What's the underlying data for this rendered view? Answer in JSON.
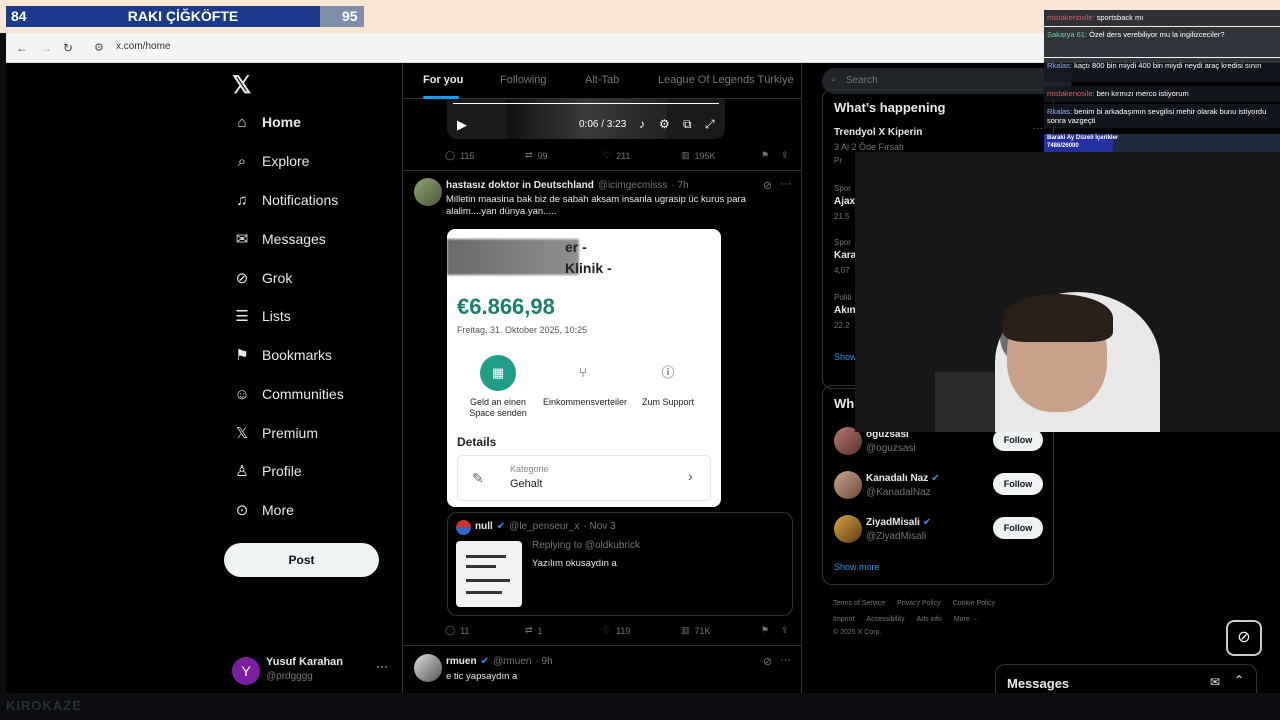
{
  "scoreboard": {
    "left": "84",
    "title": "RAKI ÇİĞKÖFTE",
    "right": "95"
  },
  "browser": {
    "url": "x.com/home"
  },
  "nav": {
    "items": [
      {
        "label": "Home",
        "icon": "home-icon"
      },
      {
        "label": "Explore",
        "icon": "search-icon"
      },
      {
        "label": "Notifications",
        "icon": "bell-icon"
      },
      {
        "label": "Messages",
        "icon": "mail-icon"
      },
      {
        "label": "Grok",
        "icon": "grok-icon"
      },
      {
        "label": "Lists",
        "icon": "list-icon"
      },
      {
        "label": "Bookmarks",
        "icon": "bookmark-icon"
      },
      {
        "label": "Communities",
        "icon": "people-icon"
      },
      {
        "label": "Premium",
        "icon": "x-icon"
      },
      {
        "label": "Profile",
        "icon": "person-icon"
      },
      {
        "label": "More",
        "icon": "more-circle-icon"
      }
    ],
    "post_label": "Post"
  },
  "account": {
    "avatar_letter": "Y",
    "name": "Yusuf Karahan",
    "handle": "@prdgggg"
  },
  "tabs": [
    "For you",
    "Following",
    "Alt-Tab",
    "League Of Legends Türkiye"
  ],
  "video": {
    "time": "0:06 / 3:23"
  },
  "tweet0_stats": {
    "replies": "115",
    "reposts": "99",
    "likes": "211",
    "views": "195K"
  },
  "tweet1": {
    "name": "hastasız doktor in Deutschland",
    "handle": "@icimgecmisss",
    "time": "· 7h",
    "text": "Milletin maasina bak biz de sabah aksam insanla ugrasip üc kurus para alalim....yan dünya yan.....",
    "card": {
      "title1": "er -",
      "title2": "Klinik -",
      "amount": "€6.866,98",
      "date": "Freitag, 31. Oktober 2025, 10:25",
      "actions": [
        "Geld an einen Space senden",
        "Einkommensverteiler",
        "Zum Support"
      ],
      "details": "Details",
      "category_label": "Kategorie",
      "category_value": "Gehalt"
    },
    "quote": {
      "name": "null",
      "handle": "@le_penseur_x",
      "time": "· Nov 3",
      "replying": "Replying to @oldkubrick",
      "text": "Yazılım okusaydın a"
    },
    "stats": {
      "replies": "11",
      "reposts": "1",
      "likes": "119",
      "views": "71K"
    }
  },
  "tweet2": {
    "name": "rmuen",
    "handle": "@rmuen",
    "time": "· 9h",
    "text": "e tic yapsaydın a"
  },
  "right": {
    "search_placeholder": "Search",
    "happening_title": "What’s happening",
    "trends": [
      {
        "title": "Trendyol X Kiperin",
        "sub": "3 Al 2 Öde Fırsatı",
        "meta": "Pr"
      },
      {
        "cat": "Spor",
        "title": "Ajax",
        "count": "21.5"
      },
      {
        "cat": "Spor",
        "title": "Kara",
        "count": "4,07"
      },
      {
        "cat": "Politi",
        "title": "Akın",
        "count": "22.2"
      }
    ],
    "show_more_short": "Show",
    "who_title": "Wh",
    "follow": [
      {
        "name": "oguzsasi",
        "handle": "@oguzsasi"
      },
      {
        "name": "Kanadalı Naz",
        "handle": "@KanadalNaz"
      },
      {
        "name": "ZiyadMisali",
        "handle": "@ZiyadMisali"
      }
    ],
    "follow_label": "Follow",
    "show_more": "Show more",
    "footer": [
      "Terms of Service",
      "Privacy Policy",
      "Cookie Policy",
      "Imprint",
      "Accessibility",
      "Ads info",
      "More ···",
      "© 2025 X Corp."
    ]
  },
  "chat": [
    {
      "user": "mistakenosile:",
      "text": "sportsback mı"
    },
    {
      "user": "Sakarya 61:",
      "text": "Özel ders verebiliyor mu la ingilizceciler?"
    },
    {
      "user": "Rkalas:",
      "text": "kaçtı 800 bin miydi 400 bin miydi neydi araç kredisi sınırı"
    },
    {
      "user": "mistakenosile:",
      "text": "ben kırmızı merco istiyorum"
    },
    {
      "user": "Rkalas:",
      "text": "benim bi arkadaşımın sevgilisi mehir olarak bunu istiyordu sonra vazgeçti"
    }
  ],
  "goal": {
    "label": "Baraki Ay Düzeli İçerikler",
    "value": "7486/26000"
  },
  "messages_label": "Messages",
  "watermark": "KIROKAZE"
}
